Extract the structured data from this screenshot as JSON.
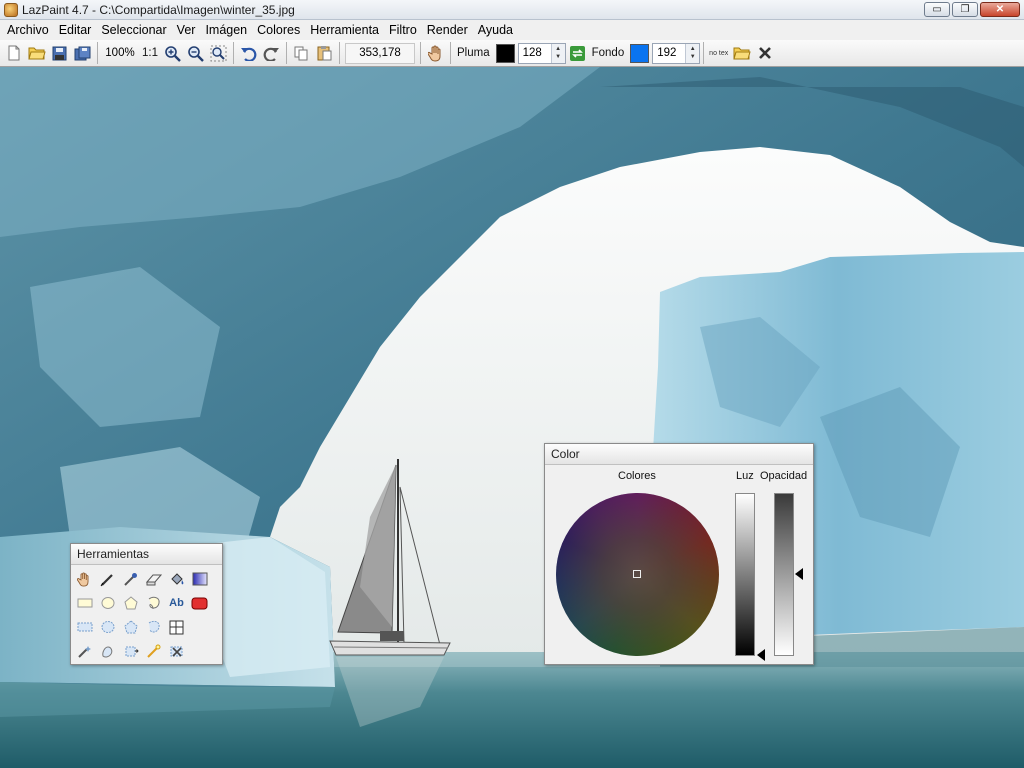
{
  "window": {
    "title": "LazPaint 4.7 - C:\\Compartida\\Imagen\\winter_35.jpg",
    "controls": {
      "minimize": "▭",
      "maximize": "❐",
      "close": "✕"
    }
  },
  "menu": [
    "Archivo",
    "Editar",
    "Seleccionar",
    "Ver",
    "Imágen",
    "Colores",
    "Herramienta",
    "Filtro",
    "Render",
    "Ayuda"
  ],
  "toolbar": {
    "zoom_level": "100%",
    "zoom_actual": "1:1",
    "coordinates": "353,178",
    "pen_label": "Pluma",
    "pen_color": "#000000",
    "pen_opacity": "128",
    "background_label": "Fondo",
    "background_color": "#0a74f0",
    "background_opacity": "192",
    "no_texture_label": "no tex"
  },
  "tools_panel": {
    "title": "Herramientas",
    "rows": [
      [
        "hand-icon",
        "pen-icon",
        "color-picker-icon",
        "eraser-icon",
        "fill-bucket-icon",
        "gradient-icon"
      ],
      [
        "rectangle-icon",
        "ellipse-icon",
        "polygon-icon",
        "spline-icon",
        "text-icon",
        "rounded-rect-icon"
      ],
      [
        "select-rect-icon",
        "select-ellipse-icon",
        "select-poly-icon",
        "select-spline-icon",
        "select-grid-icon"
      ],
      [
        "magic-wand-icon",
        "select-pen-icon",
        "move-selection-icon",
        "wand-icon",
        "deselect-icon"
      ]
    ],
    "text_tool_label": "Ab"
  },
  "color_panel": {
    "title": "Color",
    "colors_label": "Colores",
    "light_label": "Luz",
    "opacity_label": "Opacidad"
  },
  "canvas": {
    "subject": "winter_35.jpg"
  }
}
